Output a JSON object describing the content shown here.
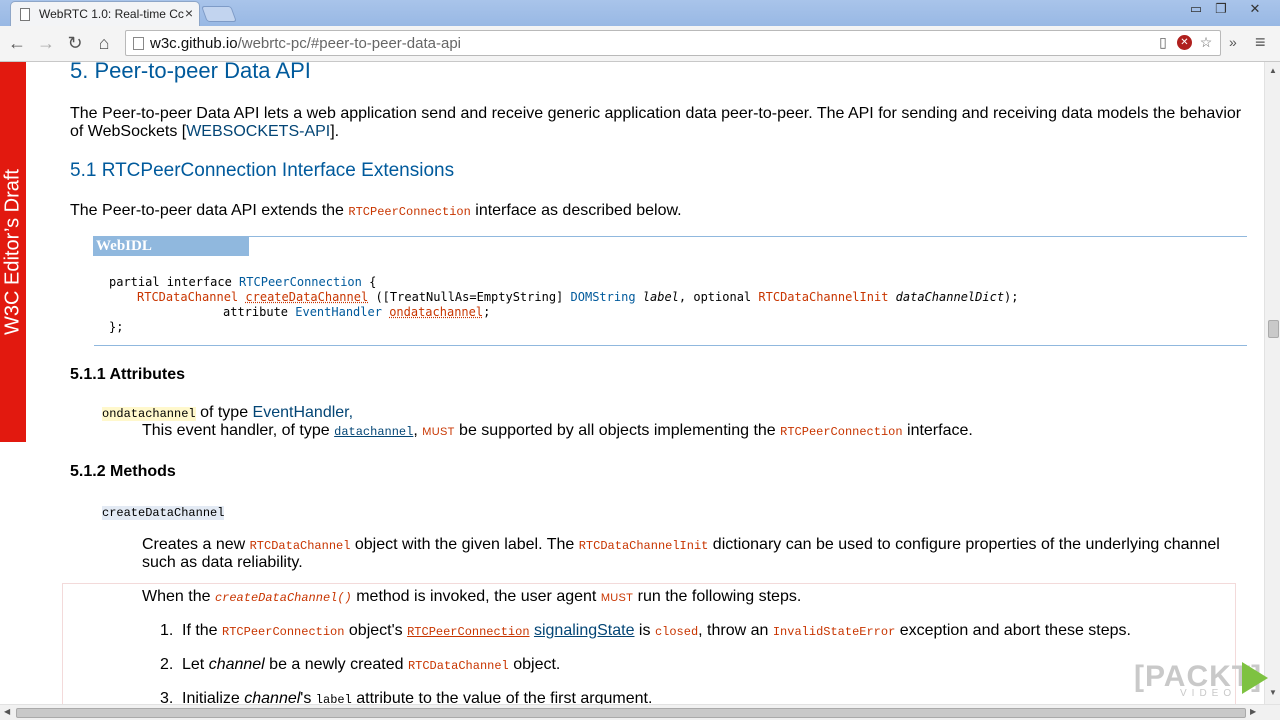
{
  "browser": {
    "tab_title": "WebRTC 1.0: Real-time Cc",
    "tab_close": "×",
    "url_host": "w3c.github.io",
    "url_rest": "/webrtc-pc/#peer-to-peer-data-api",
    "win_minimize": "▭",
    "win_restore": "❐",
    "win_close": "✕",
    "back": "←",
    "forward": "→",
    "reload": "↻",
    "home": "⌂",
    "overflow": "»",
    "menu": "≡",
    "icons": [
      "reader-mode-icon",
      "blocked-icon",
      "star-icon"
    ]
  },
  "badge": {
    "text": "W3C Editor’s Draft"
  },
  "section5": {
    "heading": "5. Peer-to-peer Data API",
    "para_a": "The Peer-to-peer Data API lets a web application send and receive generic application data peer-to-peer. The API for sending and receiving data models the behavior",
    "para_b_pre": "of WebSockets [",
    "para_b_link": "WEBSOCKETS-API",
    "para_b_post": "]."
  },
  "section51": {
    "heading": "5.1 RTCPeerConnection Interface Extensions",
    "intro_pre": "The Peer-to-peer data API extends the ",
    "intro_code": "RTCPeerConnection",
    "intro_post": " interface as described below."
  },
  "idl": {
    "tag": "WebIDL",
    "l1_kw": "partial interface ",
    "l1_type": "RTCPeerConnection",
    "l1_end": " {",
    "l2_ret": "RTCDataChannel",
    "l2_sp": " ",
    "l2_meth": "createDataChannel",
    "l2_a": " ([TreatNullAs=EmptyString] ",
    "l2_t1": "DOMString",
    "l2_sp2": " ",
    "l2_p1": "label",
    "l2_b": ", optional ",
    "l2_t2": "RTCDataChannelInit",
    "l2_sp3": " ",
    "l2_p2": "dataChannelDict",
    "l2_end": ");",
    "l3_kw": "attribute ",
    "l3_type": "EventHandler",
    "l3_sp": " ",
    "l3_name": "ondatachannel",
    "l3_end": ";",
    "l4": "};"
  },
  "attributes": {
    "heading": "5.1.1 Attributes",
    "name": "ondatachannel",
    "of_type": " of type ",
    "type_link": "EventHandler",
    "type_end": ",",
    "desc_pre": "This event handler, of type ",
    "desc_code": "datachannel",
    "desc_comma": ", ",
    "desc_must": "must",
    "desc_mid": " be supported by all objects implementing the ",
    "desc_code2": "RTCPeerConnection",
    "desc_post": " interface."
  },
  "methods": {
    "heading": "5.1.2 Methods",
    "name": "createDataChannel",
    "desc_pre": "Creates a new ",
    "desc_code": "RTCDataChannel",
    "desc_mid": " object with the given label. The ",
    "desc_code2": "RTCDataChannelInit",
    "desc_post": " dictionary can be used to configure properties of the underlying channel",
    "desc_line2": "such as data reliability.",
    "when_pre": "When the ",
    "when_code": "createDataChannel()",
    "when_mid": " method is invoked, the user agent ",
    "when_must": "must",
    "when_post": " run the following steps.",
    "step1_num": "1.",
    "step1_pre": "If the ",
    "step1_code": "RTCPeerConnection",
    "step1_mid": " object's ",
    "step1_code2": "RTCPeerConnection",
    "step1_sp": " ",
    "step1_link": "signalingState",
    "step1_is": " is ",
    "step1_closed": "closed",
    "step1_throw": ", throw an ",
    "step1_err": "InvalidStateError",
    "step1_post": " exception and abort these steps.",
    "step2_num": "2.",
    "step2_pre": "Let ",
    "step2_var": "channel",
    "step2_mid": " be a newly created ",
    "step2_code": "RTCDataChannel",
    "step2_post": " object.",
    "step3_num": "3.",
    "step3_pre": "Initialize ",
    "step3_var": "channel",
    "step3_mid": "'s ",
    "step3_code": "label",
    "step3_post": " attribute to the value of the first argument."
  },
  "watermark": {
    "brand": "[PACKT]",
    "sub": "VIDEO"
  },
  "colors": {
    "heading": "#005a9c",
    "code": "#c83500",
    "badge": "#e2190f",
    "idl_border": "#90b8de"
  }
}
